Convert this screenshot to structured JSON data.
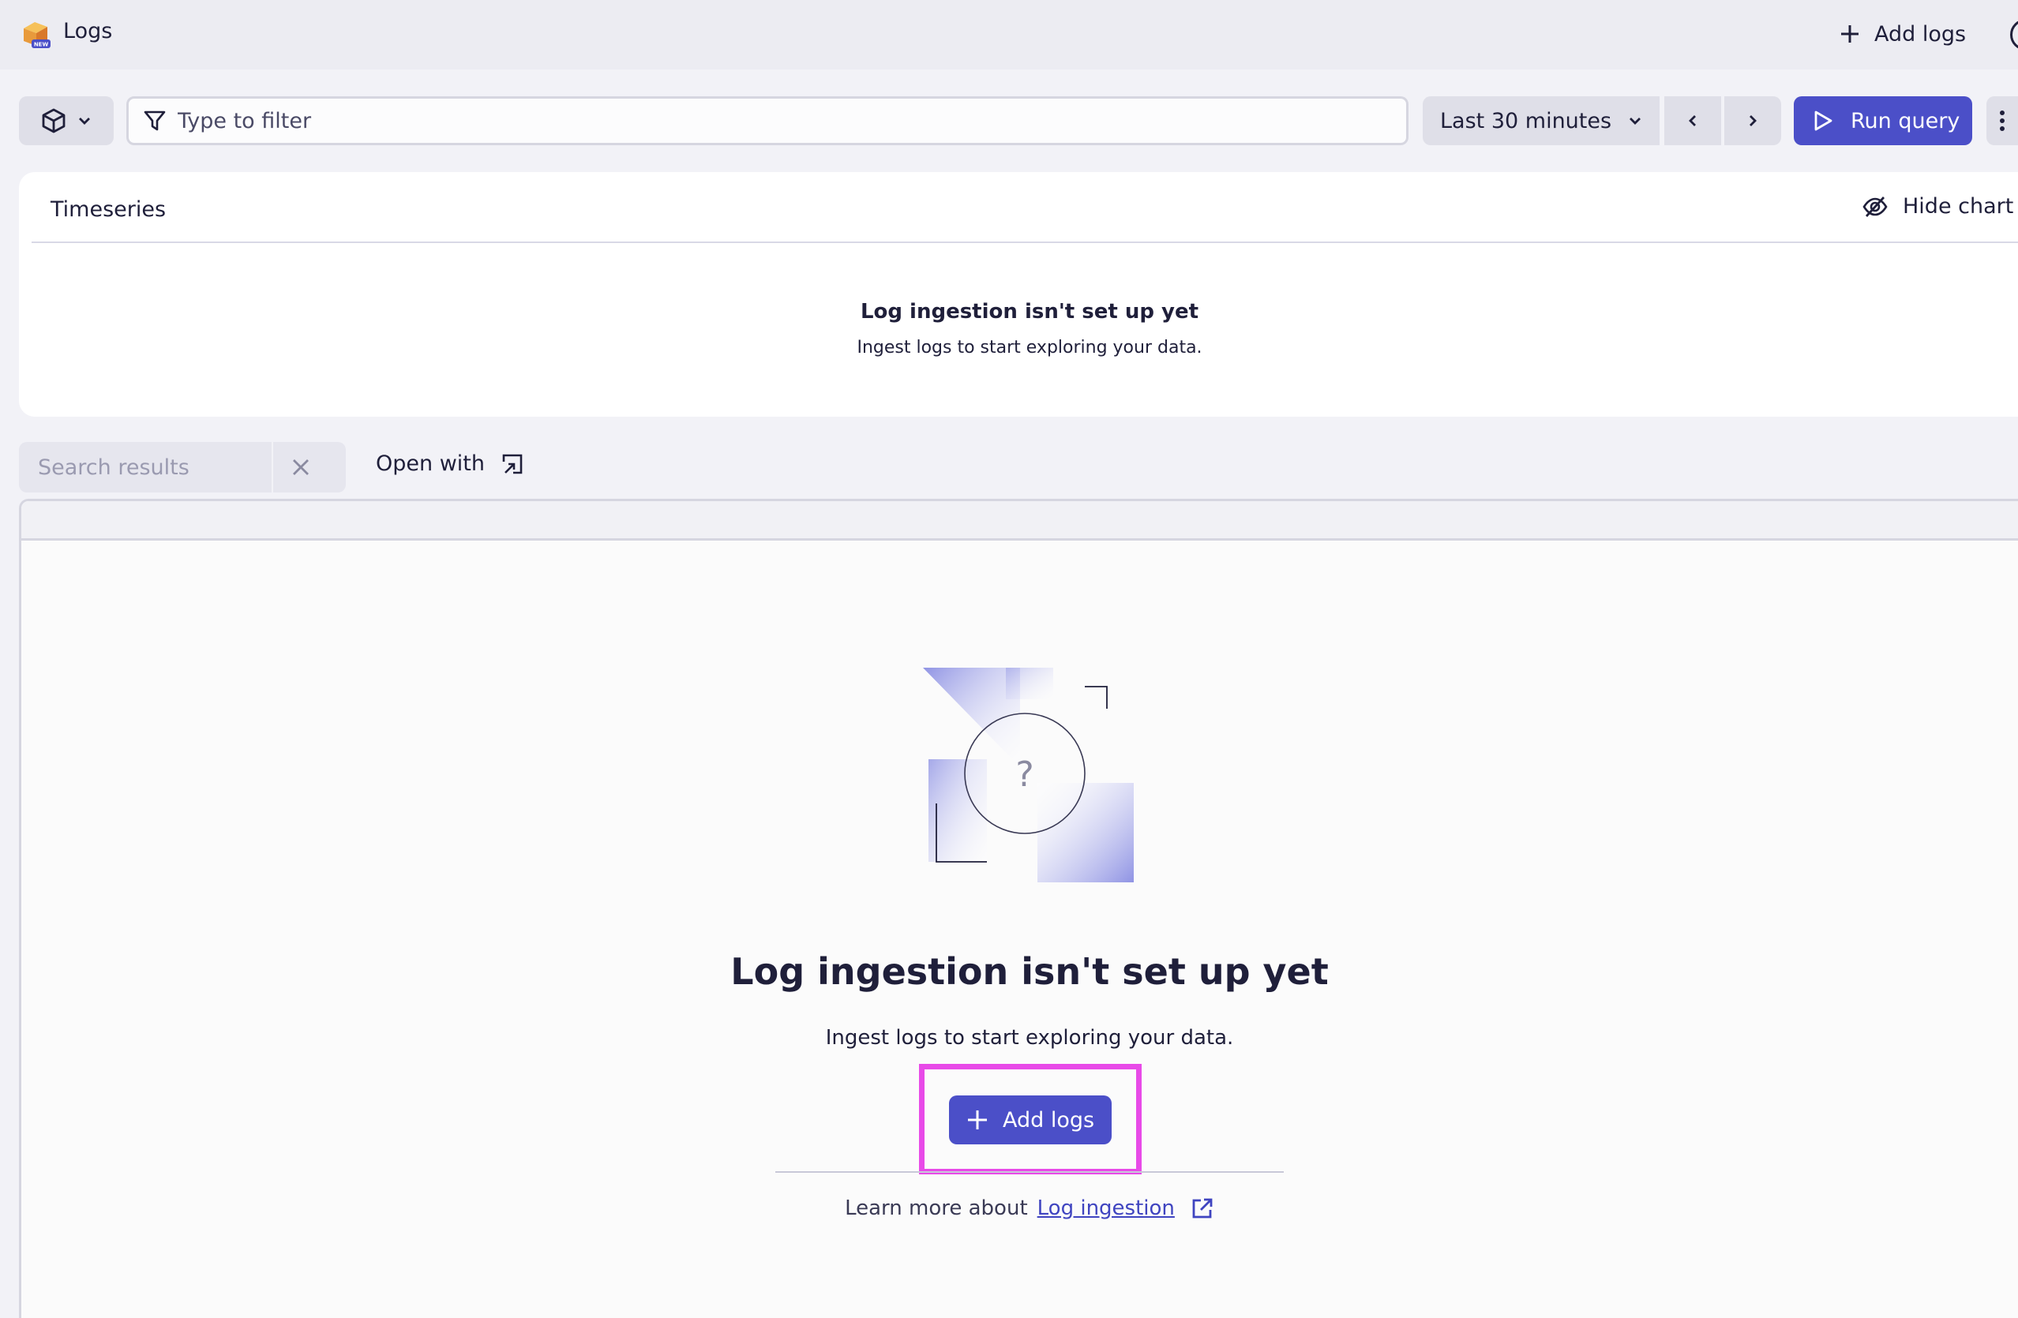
{
  "header": {
    "app_title": "Logs",
    "app_icon": "logs-app-icon",
    "add_logs_label": "Add logs"
  },
  "toolbar": {
    "filter_placeholder": "Type to filter",
    "timeframe_label": "Last 30 minutes",
    "run_query_label": "Run query"
  },
  "timeseries": {
    "title": "Timeseries",
    "hide_chart_label": "Hide chart",
    "empty_title": "Log ingestion isn't set up yet",
    "empty_subtitle": "Ingest logs to start exploring your data."
  },
  "results": {
    "search_placeholder": "Search results",
    "open_with_label": "Open with",
    "empty_title": "Log ingestion isn't set up yet",
    "empty_subtitle": "Ingest logs to start exploring your data.",
    "add_logs_label": "Add logs",
    "learn_more_prefix": "Learn more about",
    "learn_more_link": "Log ingestion"
  },
  "colors": {
    "accent": "#4b4fc8",
    "highlight": "#e84ae8",
    "background": "#f2f2f7"
  }
}
